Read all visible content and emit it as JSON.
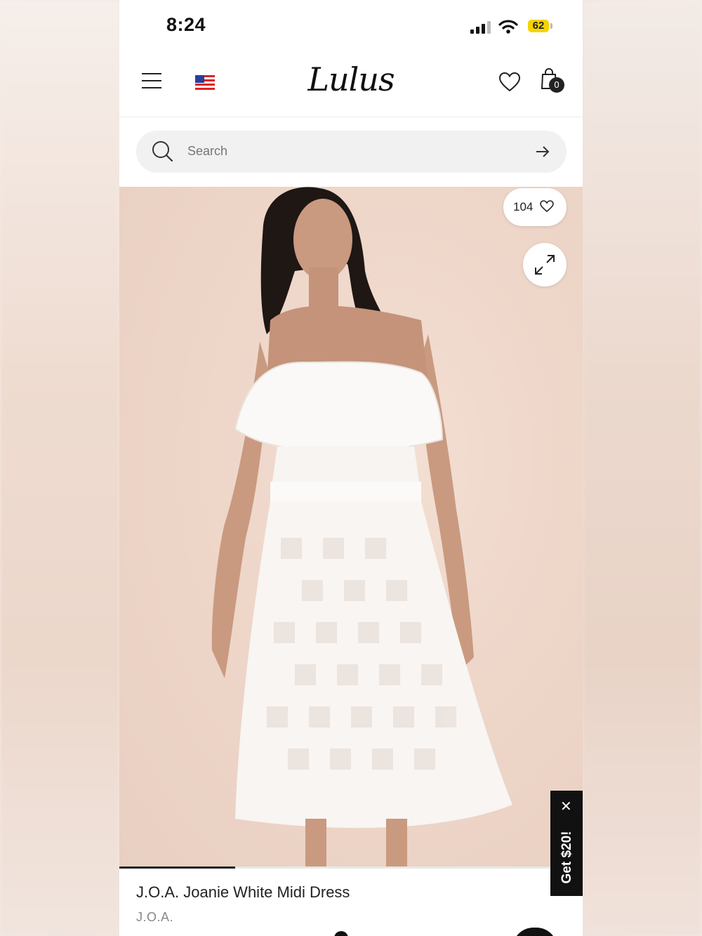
{
  "status_bar": {
    "time": "8:24",
    "battery": "62"
  },
  "header": {
    "logo": "Lulus",
    "bag_count": "0"
  },
  "search": {
    "placeholder": "Search"
  },
  "product": {
    "likes": "104",
    "name": "J.O.A. Joanie White Midi Dress",
    "brand": "J.O.A.",
    "gallery_progress": 0.25
  },
  "promo": {
    "label": "Get $20!"
  },
  "icons": [
    "menu-icon",
    "flag-icon",
    "heart-icon",
    "bag-icon",
    "search-icon",
    "arrow-right-icon",
    "expand-icon",
    "close-icon"
  ]
}
